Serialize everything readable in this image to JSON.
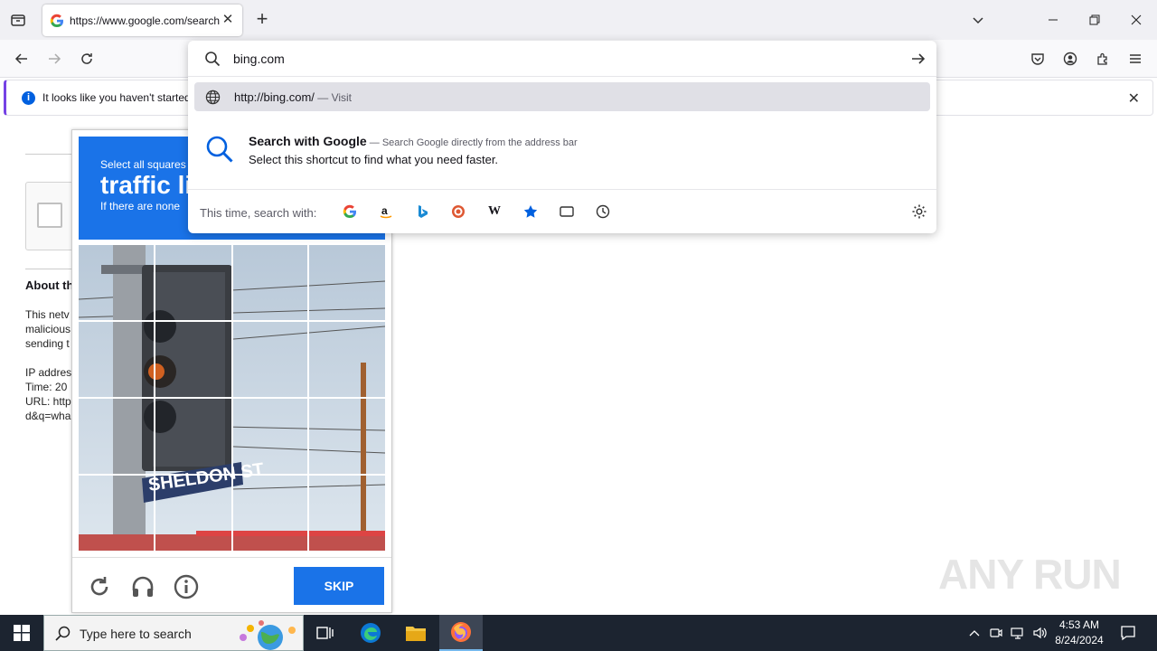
{
  "browser": {
    "tab_title": "https://www.google.com/search",
    "address_value": "bing.com"
  },
  "notification": {
    "message": "It looks like you haven't started"
  },
  "url_dropdown": {
    "visit_url": "http://bing.com/",
    "visit_sep": " — ",
    "visit_action": "Visit",
    "search_title": "Search with Google",
    "search_sep": " — ",
    "search_desc": "Search Google directly from the address bar",
    "search_sub": "Select this shortcut to find what you need faster.",
    "oneoff_label": "This time, search with:",
    "engines": [
      "Google",
      "Amazon",
      "Bing",
      "DuckDuckGo",
      "Wikipedia",
      "Bookmarks",
      "Tabs",
      "History"
    ]
  },
  "page": {
    "about_heading": "About th",
    "line1": "This netv",
    "line2": "malicious",
    "line3": "sending t",
    "line4": "IP addres",
    "line5": "Time: 20",
    "line6": "URL: http",
    "line7": "d&q=wha"
  },
  "captcha": {
    "instruction": "Select all squares",
    "target": "traffic li",
    "hint": "If there are none",
    "skip_label": "SKIP"
  },
  "taskbar": {
    "search_placeholder": "Type here to search",
    "time": "4:53 AM",
    "date": "8/24/2024"
  },
  "watermark": "ANY RUN",
  "colors": {
    "accent_blue": "#1a73e8",
    "firefox_accent": "#7542e5",
    "taskbar": "#1c2430"
  }
}
